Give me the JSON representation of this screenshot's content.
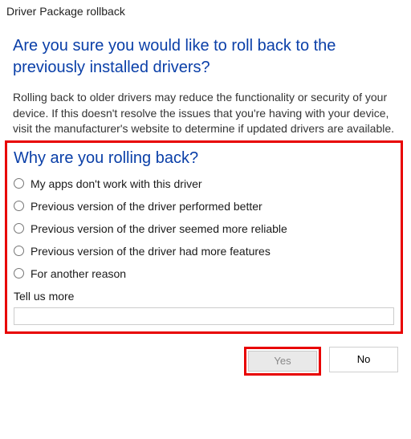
{
  "window": {
    "title": "Driver Package rollback"
  },
  "heading": "Are you sure you would like to roll back to the previously installed drivers?",
  "body": "Rolling back to older drivers may reduce the functionality or security of your device. If this doesn't resolve the issues that you're having with your device, visit the manufacturer's website to determine if updated drivers are available.",
  "survey": {
    "title": "Why are you rolling back?",
    "options": [
      "My apps don't work with this driver",
      "Previous version of the driver performed better",
      "Previous version of the driver seemed more reliable",
      "Previous version of the driver had more features",
      "For another reason"
    ],
    "tell_us_more": "Tell us more"
  },
  "buttons": {
    "yes": "Yes",
    "no": "No"
  }
}
